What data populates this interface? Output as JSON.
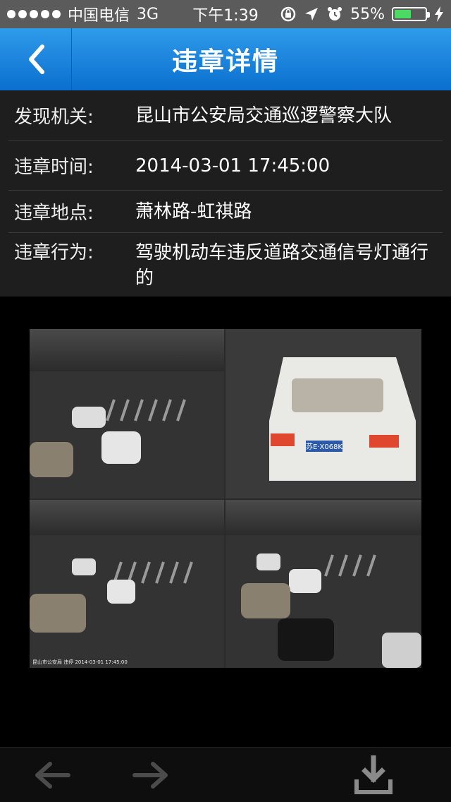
{
  "status_bar": {
    "carrier": "中国电信",
    "network": "3G",
    "time": "下午1:39",
    "battery_percent": "55%",
    "battery_level": 0.55
  },
  "nav": {
    "title": "违章详情",
    "back_icon": "chevron-left-icon"
  },
  "details": {
    "rows": [
      {
        "label": "发现机关:",
        "value": "昆山市公安局交通巡逻警察大队"
      },
      {
        "label": "违章时间:",
        "value": "2014-03-01 17:45:00"
      },
      {
        "label": "违章地点:",
        "value": "萧林路-虹祺路"
      },
      {
        "label": "违章行为:",
        "value": "驾驶机动车违反道路交通信号灯通行的"
      }
    ]
  },
  "photo": {
    "plate": "苏E·X068K",
    "caption": "昆山市公安局  违停  2014-03-01 17:45:00"
  },
  "toolbar": {
    "back_icon": "arrow-left-icon",
    "forward_icon": "arrow-right-icon",
    "download_icon": "download-icon"
  },
  "colors": {
    "nav_top": "#2f9bea",
    "nav_bottom": "#0a6fcf",
    "detail_bg": "#1e1e1e",
    "battery_green": "#4cd964"
  }
}
